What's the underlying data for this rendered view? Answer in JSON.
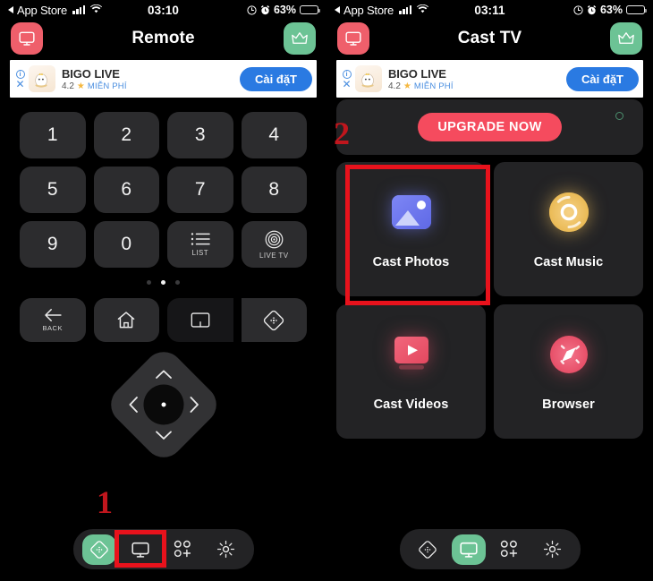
{
  "left": {
    "status_bar": {
      "back_app": "App Store",
      "time": "03:10",
      "battery_pct": "63%",
      "icons": [
        "back-triangle-icon",
        "signal-bars-icon",
        "wifi-icon",
        "location-icon",
        "alarm-icon",
        "battery-icon"
      ]
    },
    "header": {
      "title": "Remote",
      "left_icon": "monitor-icon",
      "right_icon": "crown-icon"
    },
    "ad": {
      "brand": "BIGO LIVE",
      "rating": "4.2",
      "star": "★",
      "price": "MIỄN PHÍ",
      "cta": "Cài đặT",
      "info": "i",
      "close": "✕"
    },
    "keypad": [
      {
        "label": "1",
        "sub": ""
      },
      {
        "label": "2",
        "sub": ""
      },
      {
        "label": "3",
        "sub": ""
      },
      {
        "label": "4",
        "sub": ""
      },
      {
        "label": "5",
        "sub": ""
      },
      {
        "label": "6",
        "sub": ""
      },
      {
        "label": "7",
        "sub": ""
      },
      {
        "label": "8",
        "sub": ""
      },
      {
        "label": "9",
        "sub": ""
      },
      {
        "label": "0",
        "sub": ""
      },
      {
        "label": "",
        "sub": "LIST",
        "icon": "list-icon"
      },
      {
        "label": "",
        "sub": "LIVE TV",
        "icon": "target-icon"
      }
    ],
    "page_dots": {
      "count": 3,
      "active_index": 1
    },
    "nav_row": [
      {
        "caption": "BACK",
        "icon": "arrow-left-icon"
      },
      {
        "caption": "",
        "icon": "home-icon"
      },
      {
        "caption": "",
        "icon": "pip-window-icon"
      },
      {
        "caption": "",
        "icon": "dpad-diamond-icon"
      }
    ],
    "dpad": {
      "up": "chevron-up-icon",
      "down": "chevron-down-icon",
      "left": "chevron-left-icon",
      "right": "chevron-right-icon",
      "center": "ok-dot"
    },
    "tabbar": [
      {
        "name": "remote-tab",
        "icon": "dpad-diamond-icon",
        "active": true
      },
      {
        "name": "cast-tv-tab",
        "icon": "monitor-icon",
        "active": false
      },
      {
        "name": "apps-tab",
        "icon": "apps-grid-plus-icon",
        "active": false
      },
      {
        "name": "settings-tab",
        "icon": "gear-icon",
        "active": false
      }
    ],
    "annotation": {
      "number": "1"
    }
  },
  "right": {
    "status_bar": {
      "back_app": "App Store",
      "time": "03:11",
      "battery_pct": "63%"
    },
    "header": {
      "title": "Cast TV",
      "left_icon": "monitor-icon",
      "right_icon": "crown-icon"
    },
    "ad": {
      "brand": "BIGO LIVE",
      "rating": "4.2",
      "star": "★",
      "price": "MIỄN PHÍ",
      "cta": "Cài đặT",
      "info": "i",
      "close": "✕"
    },
    "upgrade": {
      "label": "UPGRADE NOW"
    },
    "cast_cards": [
      {
        "name": "Cast Photos",
        "icon": "photo-icon"
      },
      {
        "name": "Cast Music",
        "icon": "music-disc-icon"
      },
      {
        "name": "Cast Videos",
        "icon": "video-play-icon"
      },
      {
        "name": "Browser",
        "icon": "compass-icon"
      }
    ],
    "tabbar": [
      {
        "name": "remote-tab",
        "icon": "dpad-diamond-icon",
        "active": false
      },
      {
        "name": "cast-tv-tab",
        "icon": "monitor-icon",
        "active": true
      },
      {
        "name": "apps-tab",
        "icon": "apps-grid-plus-icon",
        "active": false
      },
      {
        "name": "settings-tab",
        "icon": "gear-icon",
        "active": false
      }
    ],
    "annotation": {
      "number": "2"
    }
  },
  "colors": {
    "accent_green": "#6cc395",
    "accent_red": "#ef5f6b",
    "upgrade_red": "#f54b5e",
    "ad_blue": "#2a7ae2",
    "annotation_red": "#e8121c",
    "card_bg": "#232325",
    "key_bg": "#2c2c2e"
  }
}
